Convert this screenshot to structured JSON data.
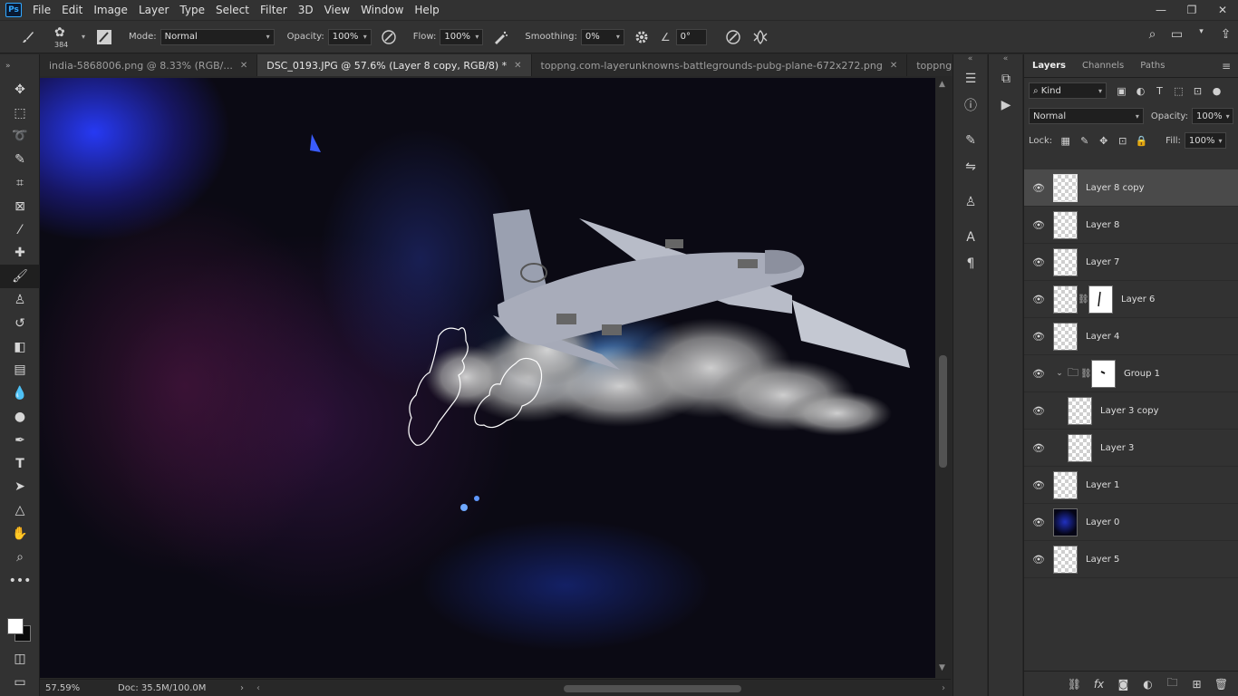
{
  "menubar": {
    "logo": "Ps",
    "items": [
      "File",
      "Edit",
      "Image",
      "Layer",
      "Type",
      "Select",
      "Filter",
      "3D",
      "View",
      "Window",
      "Help"
    ],
    "window_controls": [
      "—",
      "❐",
      "✕"
    ]
  },
  "options_bar": {
    "brush_size": "384",
    "mode_label": "Mode:",
    "mode_value": "Normal",
    "opacity_label": "Opacity:",
    "opacity_value": "100%",
    "flow_label": "Flow:",
    "flow_value": "100%",
    "smoothing_label": "Smoothing:",
    "smoothing_value": "0%",
    "angle_value": "0°"
  },
  "tabs": [
    {
      "label": "india-5868006.png @ 8.33% (RGB/...",
      "close": "✕"
    },
    {
      "label": "DSC_0193.JPG @ 57.6% (Layer 8 copy, RGB/8) *",
      "close": "✕"
    },
    {
      "label": "toppng.com-layerunknowns-battlegrounds-pubg-plane-672x272.png",
      "close": "✕"
    },
    {
      "label": "toppng.co",
      "close": ""
    }
  ],
  "status": {
    "zoom": "57.59%",
    "doc": "Doc: 35.5M/100.0M"
  },
  "layers_panel": {
    "tabs": [
      "Layers",
      "Channels",
      "Paths"
    ],
    "filter_label": "Kind",
    "blend_mode": "Normal",
    "opacity_label": "Opacity:",
    "opacity_value": "100%",
    "lock_label": "Lock:",
    "fill_label": "Fill:",
    "fill_value": "100%",
    "layers": [
      {
        "name": "Layer 8 copy"
      },
      {
        "name": "Layer 8"
      },
      {
        "name": "Layer 7"
      },
      {
        "name": "Layer 6"
      },
      {
        "name": "Layer 4"
      },
      {
        "name": "Group 1"
      },
      {
        "name": "Layer 3 copy"
      },
      {
        "name": "Layer 3"
      },
      {
        "name": "Layer 1"
      },
      {
        "name": "Layer 0"
      },
      {
        "name": "Layer 5"
      }
    ]
  },
  "colors": {
    "accent": "#31a8ff",
    "panel_bg": "#323232",
    "selected_layer": "#4a4a4a"
  }
}
